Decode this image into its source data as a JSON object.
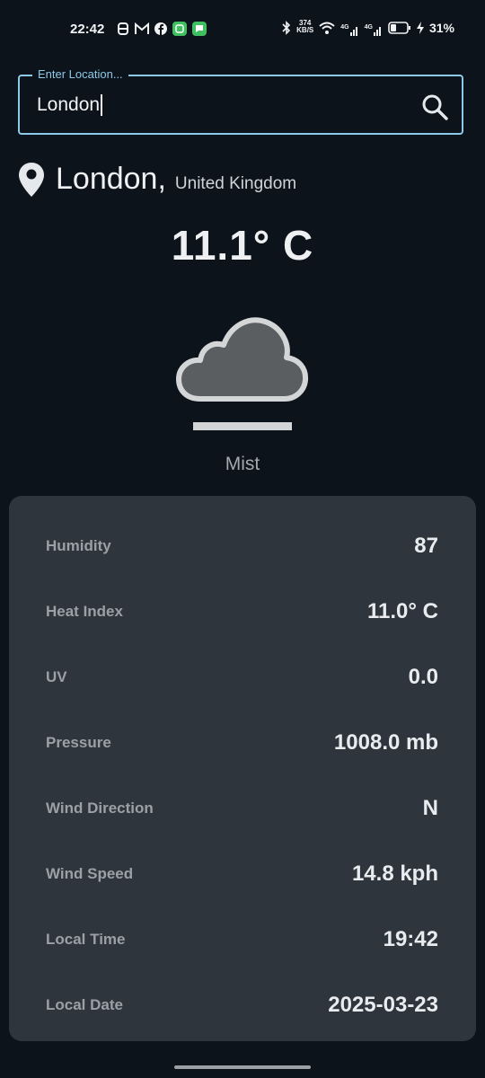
{
  "status_bar": {
    "time": "22:42",
    "network_speed_top": "374",
    "network_speed_bottom": "KB/S",
    "signal1_label": "4G",
    "signal2_label": "4G",
    "battery_percent": "31%"
  },
  "search": {
    "label": "Enter Location...",
    "value": "London"
  },
  "location": {
    "city": "London,",
    "country": "United Kingdom"
  },
  "current": {
    "temperature": "11.1° C",
    "condition": "Mist",
    "icon": "mist-cloud-icon"
  },
  "details": [
    {
      "label": "Humidity",
      "value": "87"
    },
    {
      "label": "Heat Index",
      "value": "11.0° C"
    },
    {
      "label": "UV",
      "value": "0.0"
    },
    {
      "label": "Pressure",
      "value": "1008.0 mb"
    },
    {
      "label": "Wind Direction",
      "value": "N"
    },
    {
      "label": "Wind Speed",
      "value": "14.8 kph"
    },
    {
      "label": "Local Time",
      "value": "19:42"
    },
    {
      "label": "Local Date",
      "value": "2025-03-23"
    }
  ],
  "colors": {
    "background": "#0c131a",
    "accent": "#8ec9ea",
    "card": "#2e353d",
    "label": "#9aa0a6"
  }
}
